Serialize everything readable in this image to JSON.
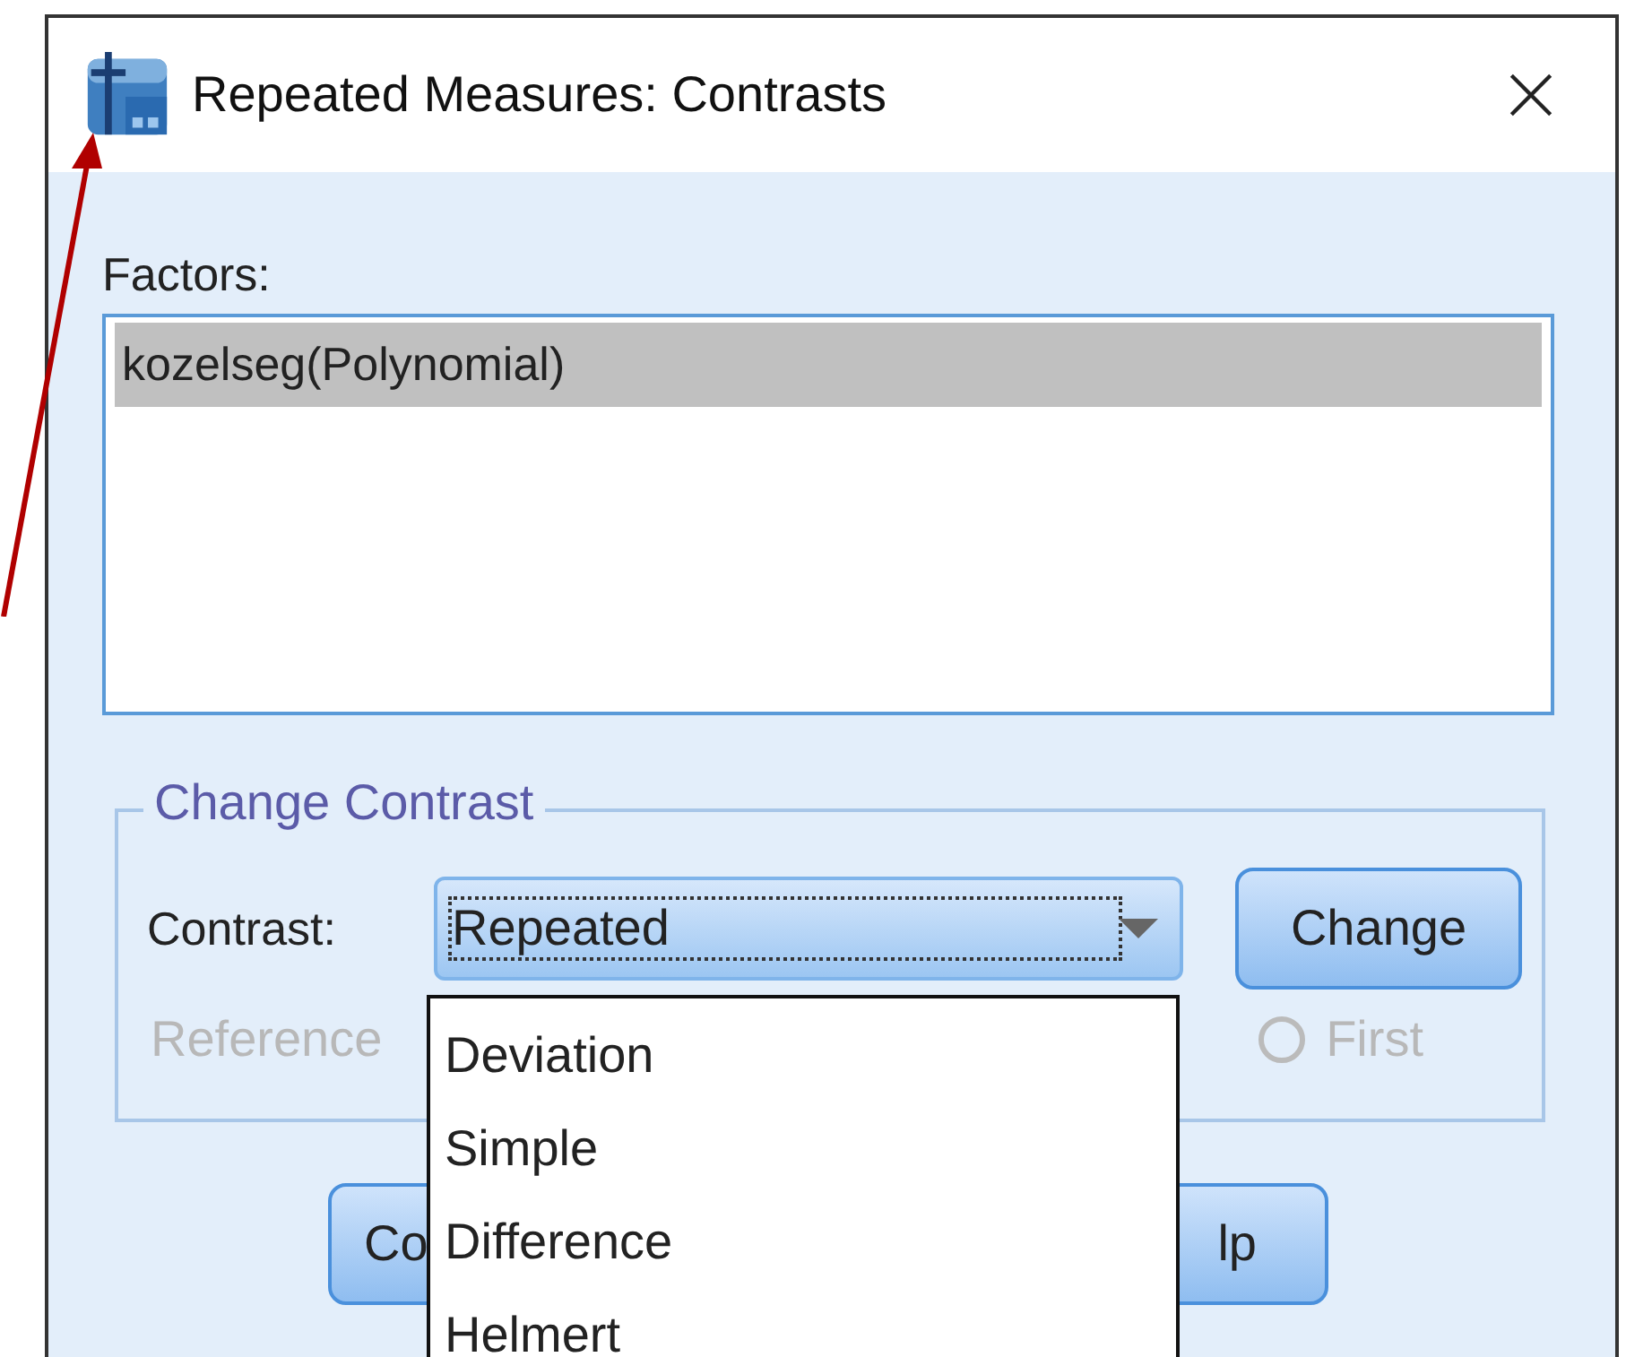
{
  "window": {
    "title": "Repeated Measures: Contrasts"
  },
  "factors": {
    "label": "Factors:",
    "items": [
      {
        "text": "kozelseg(Polynomial)",
        "selected": true
      }
    ]
  },
  "change_contrast": {
    "title": "Change Contrast",
    "contrast_label": "Contrast:",
    "contrast_value": "Repeated",
    "change_button": "Change",
    "reference_label": "Reference",
    "reference_disabled": true,
    "reference_options": [
      {
        "label": "First",
        "selected": false
      }
    ]
  },
  "dropdown": {
    "options": [
      "Deviation",
      "Simple",
      "Difference",
      "Helmert"
    ]
  },
  "buttons": [
    "Co",
    "lp"
  ]
}
